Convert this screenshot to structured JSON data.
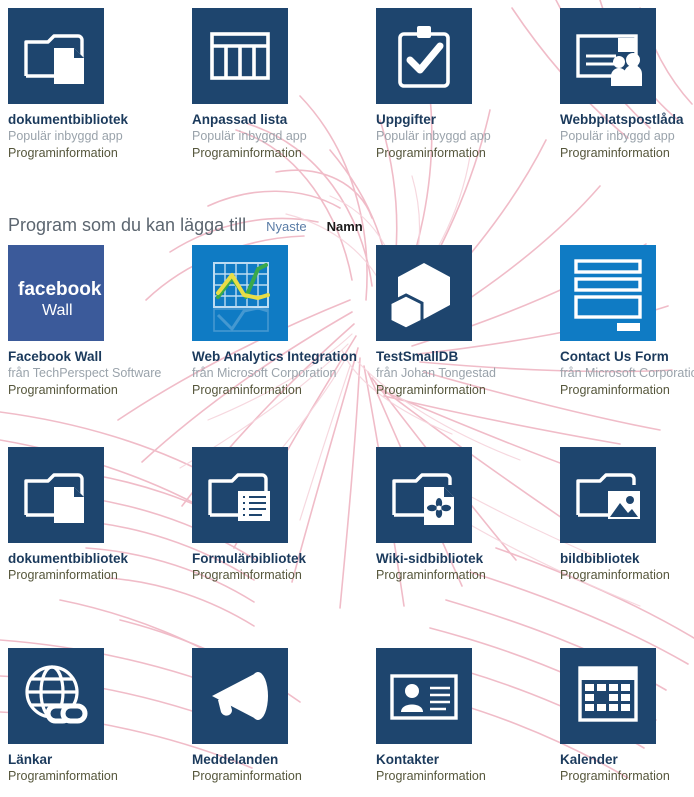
{
  "section": {
    "title": "Program som du kan lägga till",
    "sort_newest": "Nyaste",
    "sort_name": "Namn"
  },
  "labels": {
    "app_info": "Programinformation",
    "popular_builtin": "Populär inbyggd app"
  },
  "colors": {
    "tile_navy": "#1e456e",
    "tile_facebook": "#3b5a9a",
    "tile_bright_blue": "#0f7bc4",
    "title_text": "#1b3a5c",
    "publisher_text": "#9aa3ab",
    "link_text": "#56573c",
    "sort_link": "#5a7ca6",
    "watermark_pink": "#f2bfcb"
  },
  "rows": [
    {
      "name": "popular-builtin-row",
      "cards": [
        {
          "title": "dokumentbibliotek",
          "publisher": "Populär inbyggd app",
          "link": "Programinformation",
          "icon": "document-library-icon"
        },
        {
          "title": "Anpassad lista",
          "publisher": "Populär inbyggd app",
          "link": "Programinformation",
          "icon": "custom-list-icon"
        },
        {
          "title": "Uppgifter",
          "publisher": "Populär inbyggd app",
          "link": "Programinformation",
          "icon": "tasks-clipboard-icon"
        },
        {
          "title": "Webbplatspostlåda",
          "publisher": "Populär inbyggd app",
          "link": "Programinformation",
          "icon": "site-mailbox-icon"
        }
      ]
    },
    {
      "name": "available-apps-row-1",
      "cards": [
        {
          "title": "Facebook Wall",
          "publisher": "från TechPerspect Software",
          "link": "Programinformation",
          "icon": "facebook-wall-icon"
        },
        {
          "title": "Web Analytics Integration",
          "publisher": "från Microsoft Corporation",
          "link": "Programinformation",
          "icon": "web-analytics-icon"
        },
        {
          "title": "TestSmallDB",
          "publisher": "från Johan Tongestad",
          "link": "Programinformation",
          "icon": "database-hexagon-icon"
        },
        {
          "title": "Contact Us Form",
          "publisher": "från Microsoft Corporation",
          "link": "Programinformation",
          "icon": "contact-form-icon"
        }
      ]
    },
    {
      "name": "available-apps-row-2",
      "cards": [
        {
          "title": "dokumentbibliotek",
          "publisher": "",
          "link": "Programinformation",
          "icon": "document-library-icon"
        },
        {
          "title": "Formulärbibliotek",
          "publisher": "",
          "link": "Programinformation",
          "icon": "form-library-icon"
        },
        {
          "title": "Wiki-sidbibliotek",
          "publisher": "",
          "link": "Programinformation",
          "icon": "wiki-library-icon"
        },
        {
          "title": "bildbibliotek",
          "publisher": "",
          "link": "Programinformation",
          "icon": "picture-library-icon"
        }
      ]
    },
    {
      "name": "available-apps-row-3",
      "cards": [
        {
          "title": "Länkar",
          "publisher": "",
          "link": "Programinformation",
          "icon": "links-globe-icon"
        },
        {
          "title": "Meddelanden",
          "publisher": "",
          "link": "Programinformation",
          "icon": "announcements-megaphone-icon"
        },
        {
          "title": "Kontakter",
          "publisher": "",
          "link": "Programinformation",
          "icon": "contacts-card-icon"
        },
        {
          "title": "Kalender",
          "publisher": "",
          "link": "Programinformation",
          "icon": "calendar-icon"
        }
      ]
    }
  ]
}
